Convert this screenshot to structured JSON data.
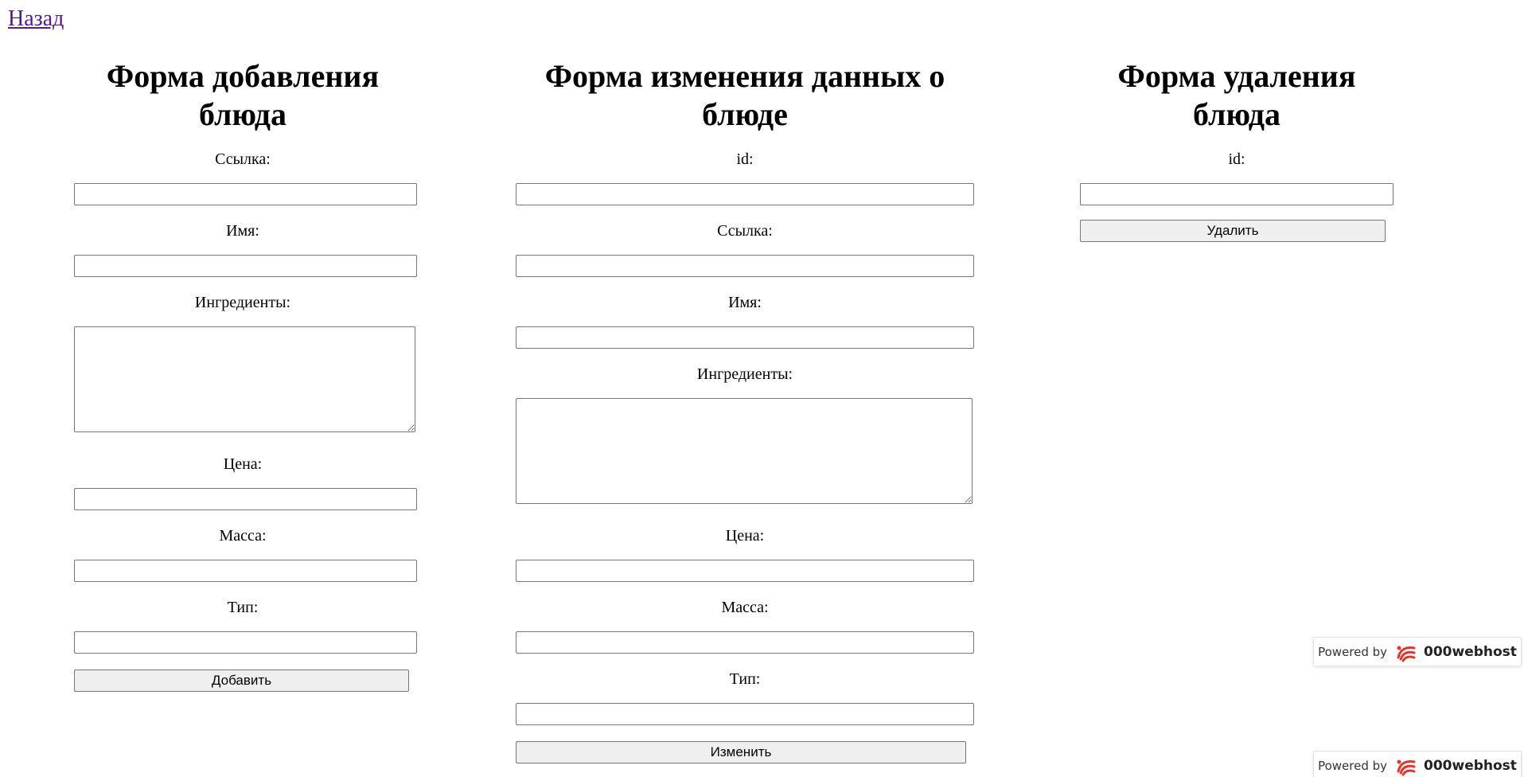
{
  "nav": {
    "back_label": "Назад"
  },
  "add_form": {
    "title": "Форма добавления блюда",
    "fields": {
      "link": "Ссылка:",
      "name": "Имя:",
      "ingredients": "Ингредиенты:",
      "price": "Цена:",
      "mass": "Масса:",
      "type": "Тип:"
    },
    "submit_label": "Добавить"
  },
  "edit_form": {
    "title": "Форма изменения данных о блюде",
    "fields": {
      "id": "id:",
      "link": "Ссылка:",
      "name": "Имя:",
      "ingredients": "Ингредиенты:",
      "price": "Цена:",
      "mass": "Масса:",
      "type": "Тип:"
    },
    "submit_label": "Изменить"
  },
  "delete_form": {
    "title": "Форма удаления блюда",
    "fields": {
      "id": "id:"
    },
    "submit_label": "Удалить"
  },
  "badges": [
    {
      "prefix": "Powered by",
      "brand": "000webhost",
      "icon": "000webhost-logo-icon"
    },
    {
      "prefix": "Powered by",
      "brand": "000webhost",
      "icon": "000webhost-logo-icon"
    }
  ],
  "colors": {
    "link_visited": "#551a8b",
    "button_bg": "#efefef",
    "input_border": "#767676",
    "brand_red": "#e8322a"
  }
}
